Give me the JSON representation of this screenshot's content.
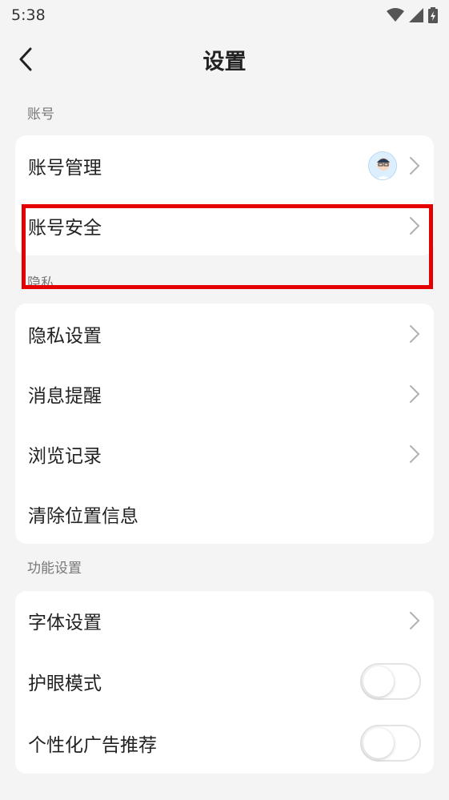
{
  "status_bar": {
    "time": "5:38"
  },
  "header": {
    "title": "设置"
  },
  "sections": {
    "account": {
      "label": "账号",
      "items": [
        "账号管理",
        "账号安全"
      ]
    },
    "privacy": {
      "label": "隐私",
      "items": [
        "隐私设置",
        "消息提醒",
        "浏览记录",
        "清除位置信息"
      ]
    },
    "features": {
      "label": "功能设置",
      "items": [
        "字体设置",
        "护眼模式",
        "个性化广告推荐"
      ]
    }
  },
  "toggles": {
    "eye_protection": false,
    "personalized_ads": false
  },
  "colors": {
    "highlight": "#e40000",
    "background": "#f4f4f4",
    "card": "#ffffff"
  },
  "icons": [
    "back-arrow-icon",
    "wifi-icon",
    "signal-icon",
    "battery-charging-icon",
    "chevron-right-icon",
    "avatar"
  ]
}
